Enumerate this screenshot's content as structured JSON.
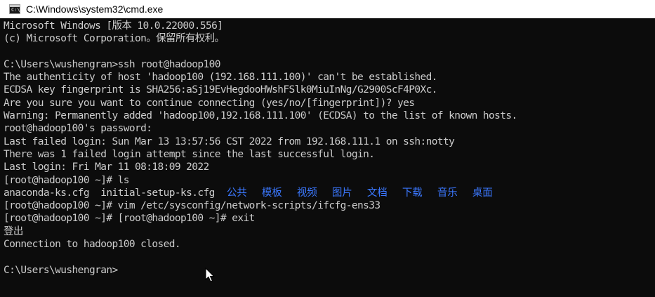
{
  "window": {
    "title": "C:\\Windows\\system32\\cmd.exe",
    "icon": "cmd-icon",
    "icon_text": "C:\\"
  },
  "console": {
    "lines": [
      "Microsoft Windows [版本 10.0.22000.556]",
      "(c) Microsoft Corporation。保留所有权利。",
      "",
      "C:\\Users\\wushengran>ssh root@hadoop100",
      "The authenticity of host 'hadoop100 (192.168.111.100)' can't be established.",
      "ECDSA key fingerprint is SHA256:aSj19EvHegdooHWshFSlk0MiuInNg/G2900ScF4P0Xc.",
      "Are you sure you want to continue connecting (yes/no/[fingerprint])? yes",
      "Warning: Permanently added 'hadoop100,192.168.111.100' (ECDSA) to the list of known hosts.",
      "root@hadoop100's password:",
      "Last failed login: Sun Mar 13 13:57:56 CST 2022 from 192.168.111.1 on ssh:notty",
      "There was 1 failed login attempt since the last successful login.",
      "Last login: Fri Mar 11 08:18:09 2022",
      "[root@hadoop100 ~]# ls"
    ],
    "ls_output": {
      "files": "anaconda-ks.cfg  initial-setup-ks.cfg",
      "dirs": [
        "公共",
        "模板",
        "视频",
        "图片",
        "文档",
        "下载",
        "音乐",
        "桌面"
      ]
    },
    "lines_after": [
      "[root@hadoop100 ~]# vim /etc/sysconfig/network-scripts/ifcfg-ens33",
      "[root@hadoop100 ~]# [root@hadoop100 ~]# exit",
      "登出",
      "Connection to hadoop100 closed.",
      "",
      "C:\\Users\\wushengran>"
    ]
  },
  "colors": {
    "background": "#0c0c0c",
    "text": "#cccccc",
    "directory": "#3b78ff",
    "titlebar": "#ffffff"
  },
  "cursor": {
    "icon": "mouse-pointer-icon"
  }
}
